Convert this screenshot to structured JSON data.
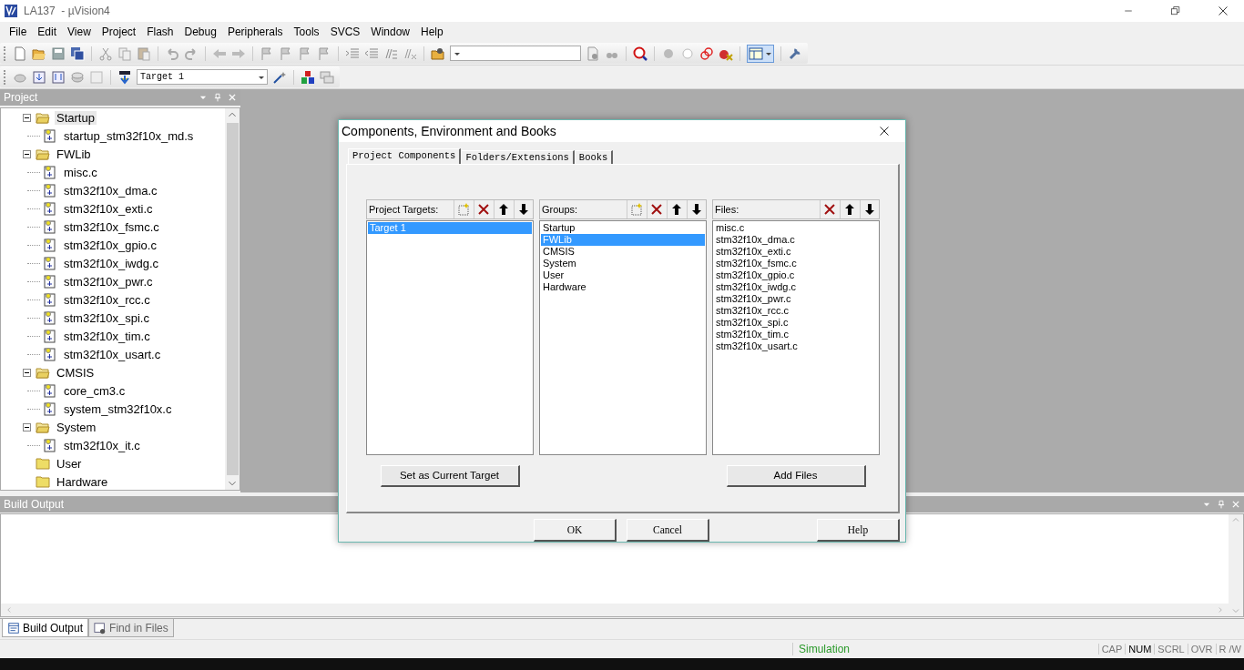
{
  "window": {
    "title": "LA137  - µVision4"
  },
  "menu": [
    "File",
    "Edit",
    "View",
    "Project",
    "Flash",
    "Debug",
    "Peripherals",
    "Tools",
    "SVCS",
    "Window",
    "Help"
  ],
  "toolbar": {
    "target_combo": {
      "value": "Target 1"
    }
  },
  "project_panel": {
    "title": "Project",
    "tree": [
      {
        "label": "Startup",
        "kind": "group",
        "expanded": true,
        "selected": true,
        "children": [
          {
            "label": "startup_stm32f10x_md.s",
            "kind": "file",
            "selected": false
          }
        ]
      },
      {
        "label": "FWLib",
        "kind": "group",
        "expanded": true,
        "selected": false,
        "children": [
          {
            "label": "misc.c",
            "kind": "file",
            "selected": false
          },
          {
            "label": "stm32f10x_dma.c",
            "kind": "file",
            "selected": false
          },
          {
            "label": "stm32f10x_exti.c",
            "kind": "file",
            "selected": false
          },
          {
            "label": "stm32f10x_fsmc.c",
            "kind": "file",
            "selected": false
          },
          {
            "label": "stm32f10x_gpio.c",
            "kind": "file",
            "selected": false
          },
          {
            "label": "stm32f10x_iwdg.c",
            "kind": "file",
            "selected": false
          },
          {
            "label": "stm32f10x_pwr.c",
            "kind": "file",
            "selected": false
          },
          {
            "label": "stm32f10x_rcc.c",
            "kind": "file",
            "selected": false
          },
          {
            "label": "stm32f10x_spi.c",
            "kind": "file",
            "selected": false
          },
          {
            "label": "stm32f10x_tim.c",
            "kind": "file",
            "selected": false
          },
          {
            "label": "stm32f10x_usart.c",
            "kind": "file",
            "selected": false
          }
        ]
      },
      {
        "label": "CMSIS",
        "kind": "group",
        "expanded": true,
        "selected": false,
        "children": [
          {
            "label": "core_cm3.c",
            "kind": "file",
            "selected": false
          },
          {
            "label": "system_stm32f10x.c",
            "kind": "file",
            "selected": false
          }
        ]
      },
      {
        "label": "System",
        "kind": "group",
        "expanded": true,
        "selected": false,
        "children": [
          {
            "label": "stm32f10x_it.c",
            "kind": "file",
            "selected": false
          }
        ]
      },
      {
        "label": "User",
        "kind": "group",
        "expanded": false,
        "selected": false
      },
      {
        "label": "Hardware",
        "kind": "group",
        "expanded": false,
        "selected": false
      }
    ]
  },
  "dialog": {
    "title": "Components, Environment and Books",
    "tabs": [
      {
        "label": "Project Components",
        "selected": true
      },
      {
        "label": "Folders/Extensions",
        "selected": false
      },
      {
        "label": "Books",
        "selected": false
      }
    ],
    "lists": [
      {
        "title": "Project Targets:",
        "tools": [
          {
            "kind": "new"
          },
          {
            "kind": "delete"
          },
          {
            "kind": "up"
          },
          {
            "kind": "down"
          }
        ],
        "items": [
          {
            "label": "Target 1",
            "selected": true
          }
        ],
        "button": "Set as Current Target"
      },
      {
        "title": "Groups:",
        "tools": [
          {
            "kind": "new"
          },
          {
            "kind": "delete"
          },
          {
            "kind": "up"
          },
          {
            "kind": "down"
          }
        ],
        "items": [
          {
            "label": "Startup",
            "selected": false
          },
          {
            "label": "FWLib",
            "selected": true
          },
          {
            "label": "CMSIS",
            "selected": false
          },
          {
            "label": "System",
            "selected": false
          },
          {
            "label": "User",
            "selected": false
          },
          {
            "label": "Hardware",
            "selected": false
          }
        ]
      },
      {
        "title": "Files:",
        "tools": [
          {
            "kind": "delete"
          },
          {
            "kind": "up"
          },
          {
            "kind": "down"
          }
        ],
        "items": [
          {
            "label": "misc.c",
            "selected": false
          },
          {
            "label": "stm32f10x_dma.c",
            "selected": false
          },
          {
            "label": "stm32f10x_exti.c",
            "selected": false
          },
          {
            "label": "stm32f10x_fsmc.c",
            "selected": false
          },
          {
            "label": "stm32f10x_gpio.c",
            "selected": false
          },
          {
            "label": "stm32f10x_iwdg.c",
            "selected": false
          },
          {
            "label": "stm32f10x_pwr.c",
            "selected": false
          },
          {
            "label": "stm32f10x_rcc.c",
            "selected": false
          },
          {
            "label": "stm32f10x_spi.c",
            "selected": false
          },
          {
            "label": "stm32f10x_tim.c",
            "selected": false
          },
          {
            "label": "stm32f10x_usart.c",
            "selected": false
          }
        ],
        "button": "Add Files"
      }
    ],
    "buttons": [
      "OK",
      "Cancel",
      "Help"
    ]
  },
  "output_panel": {
    "title": "Build Output"
  },
  "bottom_tabs": [
    {
      "label": "Build Output",
      "selected": true
    },
    {
      "label": "Find in Files",
      "selected": false
    }
  ],
  "status_bar": {
    "mode": "Simulation",
    "indicators": [
      {
        "label": "CAP",
        "on": false
      },
      {
        "label": "NUM",
        "on": true
      },
      {
        "label": "SCRL",
        "on": false
      },
      {
        "label": "OVR",
        "on": false
      },
      {
        "label": "R /W",
        "on": false
      }
    ]
  }
}
